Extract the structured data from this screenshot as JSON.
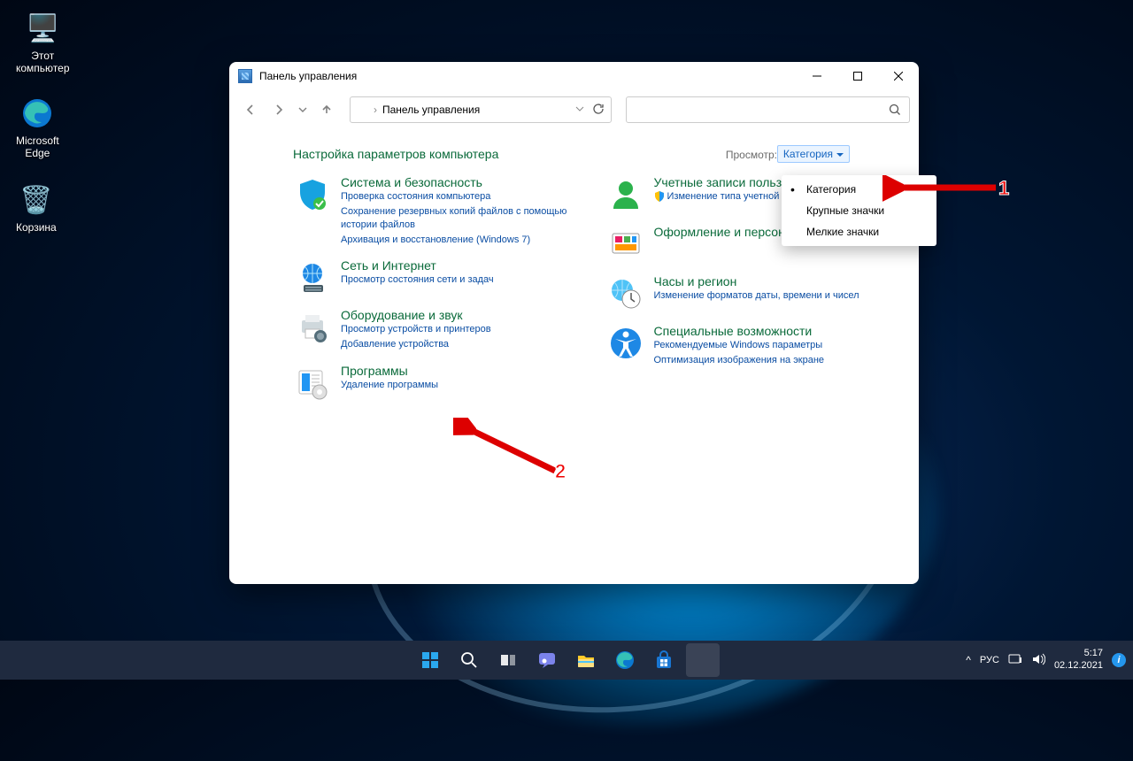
{
  "desktop": {
    "this_pc": "Этот\nкомпьютер",
    "edge": "Microsoft\nEdge",
    "recycle": "Корзина"
  },
  "window": {
    "title": "Панель управления",
    "address": "Панель управления"
  },
  "cp": {
    "heading": "Настройка параметров компьютера",
    "view_label": "Просмотр:",
    "view_value": "Категория",
    "left": [
      {
        "title": "Система и безопасность",
        "links": [
          "Проверка состояния компьютера",
          "Сохранение резервных копий файлов с помощью истории файлов",
          "Архивация и восстановление (Windows 7)"
        ]
      },
      {
        "title": "Сеть и Интернет",
        "links": [
          "Просмотр состояния сети и задач"
        ]
      },
      {
        "title": "Оборудование и звук",
        "links": [
          "Просмотр устройств и принтеров",
          "Добавление устройства"
        ]
      },
      {
        "title": "Программы",
        "links": [
          "Удаление программы"
        ]
      }
    ],
    "right": [
      {
        "title": "Учетные записи польз",
        "links": [
          "Изменение типа учетной за"
        ],
        "shield": true
      },
      {
        "title": "Оформление и персонализация",
        "links": []
      },
      {
        "title": "Часы и регион",
        "links": [
          "Изменение форматов даты, времени и чисел"
        ]
      },
      {
        "title": "Специальные возможности",
        "links": [
          "Рекомендуемые Windows параметры",
          "Оптимизация изображения на экране"
        ]
      }
    ]
  },
  "dropdown": {
    "items": [
      "Категория",
      "Крупные значки",
      "Мелкие значки"
    ],
    "selected": 0
  },
  "annotations": {
    "num1": "1",
    "num2": "2"
  },
  "taskbar": {
    "lang": "РУС",
    "time": "5:17",
    "date": "02.12.2021"
  }
}
